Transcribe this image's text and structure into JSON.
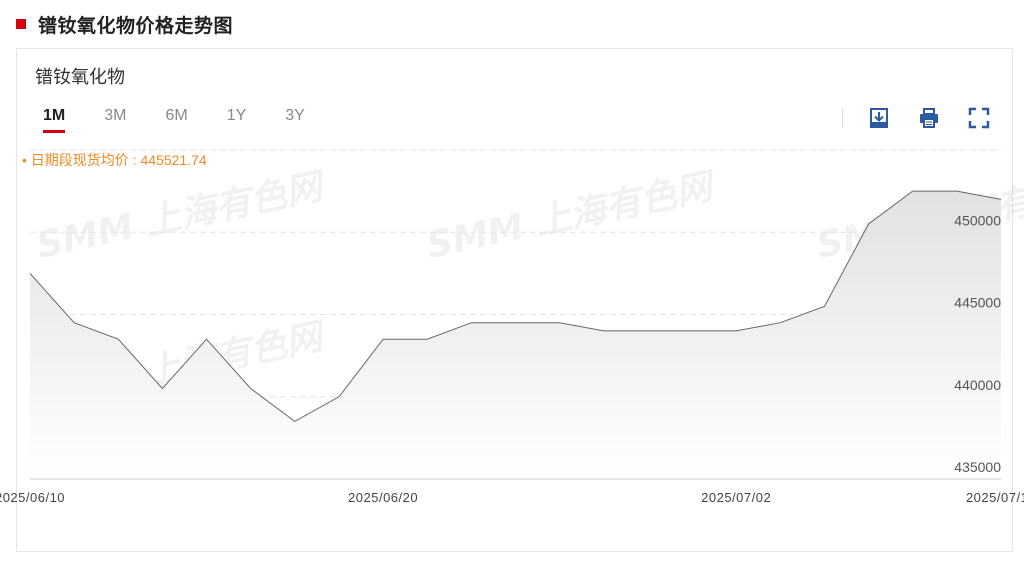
{
  "header": {
    "title": "镨钕氧化物价格走势图"
  },
  "card": {
    "title": "镨钕氧化物"
  },
  "tabs": [
    {
      "label": "1M",
      "active": true
    },
    {
      "label": "3M",
      "active": false
    },
    {
      "label": "6M",
      "active": false
    },
    {
      "label": "1Y",
      "active": false
    },
    {
      "label": "3Y",
      "active": false
    }
  ],
  "toolbar": {
    "download_icon": "download-icon",
    "print_icon": "print-icon",
    "fullscreen_icon": "fullscreen-icon"
  },
  "summary": {
    "avg_text": "日期段现货均价 : 445521.74"
  },
  "watermark": {
    "text": "SMM 上海有色网"
  },
  "colors": {
    "accent": "#d7000f",
    "avg_label": "#f08a24",
    "line": "#666666",
    "icon_blue": "#2c5aa0"
  },
  "chart_data": {
    "type": "area",
    "x": [
      "2025-06-10",
      "2025-06-11",
      "2025-06-12",
      "2025-06-13",
      "2025-06-16",
      "2025-06-17",
      "2025-06-18",
      "2025-06-19",
      "2025-06-20",
      "2025-06-23",
      "2025-06-24",
      "2025-06-25",
      "2025-06-26",
      "2025-06-27",
      "2025-06-30",
      "2025-07-01",
      "2025-07-02",
      "2025-07-03",
      "2025-07-04",
      "2025-07-07",
      "2025-07-08",
      "2025-07-09",
      "2025-07-10"
    ],
    "series": [
      {
        "values": [
          447500,
          444500,
          443500,
          440500,
          443500,
          440500,
          438500,
          440000,
          443500,
          443500,
          444500,
          444500,
          444500,
          444000,
          444000,
          444000,
          444000,
          444500,
          445500,
          450500,
          452500,
          452500,
          452000
        ]
      }
    ],
    "x_tick_labels": [
      "2025/06/10",
      "2025/06/20",
      "2025/07/02",
      "2025/07/10"
    ],
    "y_ticks": [
      435000,
      440000,
      445000,
      450000
    ],
    "ylim": [
      435000,
      455000
    ],
    "grid": "horizontal-dashed",
    "title": "",
    "xlabel": "",
    "ylabel": ""
  }
}
